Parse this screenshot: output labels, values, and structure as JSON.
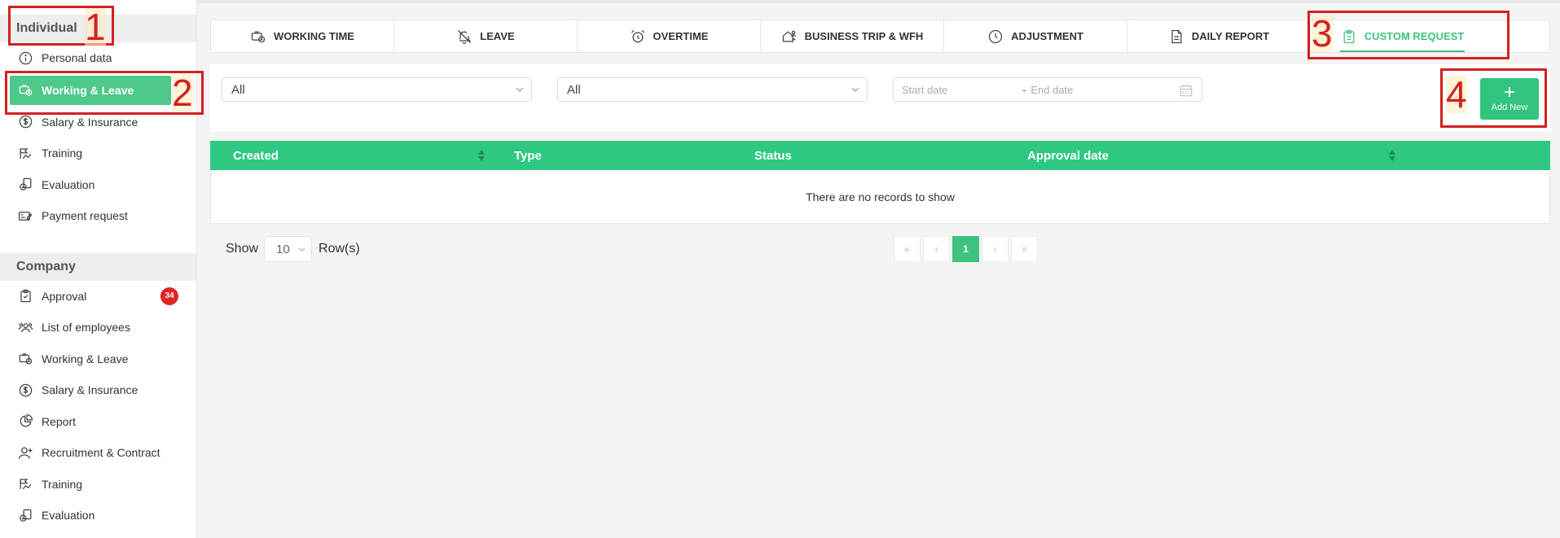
{
  "sidebar": {
    "individual_title": "Individual",
    "individual_items": [
      {
        "label": "Personal data",
        "icon": "info-icon"
      },
      {
        "label": "Working & Leave",
        "icon": "briefcase-clock-icon",
        "active": true
      },
      {
        "label": "Salary & Insurance",
        "icon": "dollar-circle-icon"
      },
      {
        "label": "Training",
        "icon": "training-icon"
      },
      {
        "label": "Evaluation",
        "icon": "evaluation-icon"
      },
      {
        "label": "Payment request",
        "icon": "payment-icon"
      }
    ],
    "company_title": "Company",
    "company_items": [
      {
        "label": "Approval",
        "icon": "clipboard-check-icon",
        "badge": "34"
      },
      {
        "label": "List of employees",
        "icon": "users-icon"
      },
      {
        "label": "Working & Leave",
        "icon": "briefcase-clock-icon"
      },
      {
        "label": "Salary & Insurance",
        "icon": "dollar-circle-icon"
      },
      {
        "label": "Report",
        "icon": "pie-chart-icon"
      },
      {
        "label": "Recruitment & Contract",
        "icon": "user-plus-icon"
      },
      {
        "label": "Training",
        "icon": "training-icon"
      },
      {
        "label": "Evaluation",
        "icon": "evaluation-icon"
      }
    ]
  },
  "tabs": [
    {
      "label": "WORKING TIME",
      "icon": "briefcase-clock-icon"
    },
    {
      "label": "LEAVE",
      "icon": "bell-off-icon"
    },
    {
      "label": "OVERTIME",
      "icon": "alarm-icon"
    },
    {
      "label": "BUSINESS TRIP & WFH",
      "icon": "home-run-icon"
    },
    {
      "label": "ADJUSTMENT",
      "icon": "clock-icon"
    },
    {
      "label": "DAILY REPORT",
      "icon": "document-icon"
    },
    {
      "label": "CUSTOM REQUEST",
      "icon": "clipboard-icon",
      "active": true
    }
  ],
  "filters": {
    "select1_value": "All",
    "select2_value": "All",
    "start_date_placeholder": "Start date",
    "separator": "-",
    "end_date_placeholder": "End date",
    "add_label": "Add New",
    "add_plus": "+"
  },
  "table": {
    "columns": [
      "Created",
      "Type",
      "Status",
      "Approval date"
    ],
    "empty_text": "There are no records to show"
  },
  "pagination": {
    "show_label": "Show",
    "rows_value": "10",
    "rows_label": "Row(s)",
    "first": "«",
    "prev": "‹",
    "current": "1",
    "next": "›",
    "last": "»"
  },
  "annotations": [
    "1",
    "2",
    "3",
    "4"
  ],
  "colors": {
    "accent": "#31c47f",
    "annotation": "#d42020",
    "badge": "#e02424"
  }
}
